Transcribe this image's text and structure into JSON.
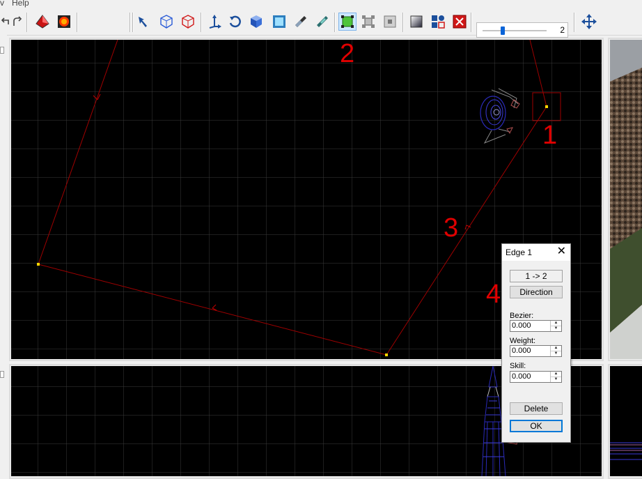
{
  "menu": {
    "items": [
      "v",
      "Help"
    ]
  },
  "toolbar": {
    "buttons": [
      {
        "name": "undo-icon"
      },
      {
        "name": "redo-icon"
      },
      {
        "name": "red-diamond-icon"
      },
      {
        "name": "record-icon"
      },
      {
        "name": "select-tool-icon"
      },
      {
        "name": "wireframe-cube-icon"
      },
      {
        "name": "red-cube-icon"
      },
      {
        "name": "axis-move-icon"
      },
      {
        "name": "rotate-icon"
      },
      {
        "name": "solid-cube-icon"
      },
      {
        "name": "textured-cube-icon"
      },
      {
        "name": "knife-icon"
      },
      {
        "name": "mirror-icon"
      },
      {
        "name": "select-box-icon",
        "active": true
      },
      {
        "name": "group-icon"
      },
      {
        "name": "square-icon"
      },
      {
        "name": "gradient-icon"
      },
      {
        "name": "shapes-icon"
      },
      {
        "name": "close-red-icon"
      },
      {
        "name": "move-arrows-icon"
      }
    ],
    "slider_value": "2",
    "slider_level": 0.3
  },
  "dialog": {
    "title": "Edge 1",
    "close_glyph": "✕",
    "edge_label": "1 -> 2",
    "direction_label": "Direction",
    "bezier_label": "Bezier:",
    "bezier_value": "0.000",
    "weight_label": "Weight:",
    "weight_value": "0.000",
    "skill_label": "Skill:",
    "skill_value": "0.000",
    "delete_label": "Delete",
    "ok_label": "OK"
  },
  "annotations": [
    "1",
    "2",
    "3",
    "4"
  ],
  "colors": {
    "path_red": "#a00000",
    "grid": "#3a3a3a",
    "node_yellow": "#ffd800",
    "accent": "#0078d7"
  }
}
